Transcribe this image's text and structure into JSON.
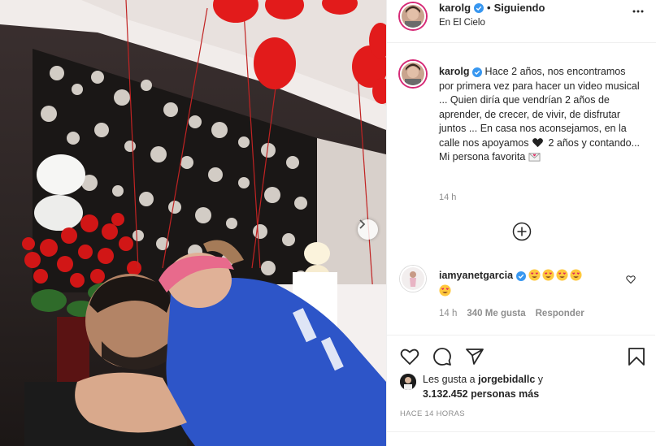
{
  "post": {
    "username": "karolg",
    "follow_separator": "•",
    "follow_status": "Siguiendo",
    "location": "En El Cielo",
    "more_icon": "more-horizontal-icon"
  },
  "caption": {
    "username": "karolg",
    "text_1": "Hace 2 años, nos encontramos por primera vez para hacer un video musical ... Quien diría que vendrían 2 años de aprender, de crecer, de vivir, de disfrutar juntos ... En casa nos aconsejamos, en la calle nos apoyamos",
    "text_2": "2 años y contando... Mi persona favorita",
    "time": "14 h"
  },
  "comment": {
    "username": "iamyanetgarcia",
    "emoji_count": 5,
    "time": "14 h",
    "likes": "340 Me gusta",
    "reply": "Responder"
  },
  "likes": {
    "prefix": "Les gusta a",
    "user": "jorgebidallc",
    "connector": "y",
    "others": "3.132.452 personas más"
  },
  "posted_ago": "HACE 14 HORAS",
  "colors": {
    "verified": "#3897f0",
    "story_ring": "#d62976",
    "secondary_text": "#8e8e8e",
    "balloon": "#e21b1b",
    "jersey": "#2d55c8",
    "bandana": "#e86a8c"
  },
  "icons": [
    "verified-icon",
    "add-circle-icon",
    "heart-icon",
    "comment-icon",
    "share-icon",
    "bookmark-icon",
    "chevron-right-icon",
    "heart-eyes-emoji",
    "black-heart-emoji",
    "love-letter-emoji"
  ]
}
